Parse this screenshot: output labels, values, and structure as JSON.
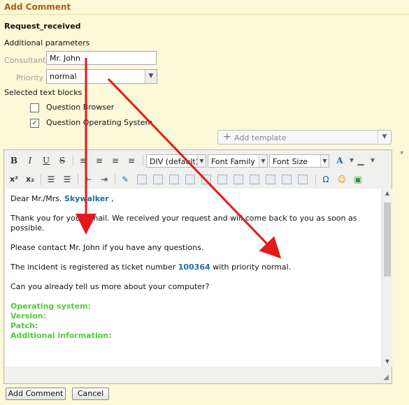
{
  "header": {
    "title": "Add Comment"
  },
  "template": {
    "name": "Request_received"
  },
  "form": {
    "additional_params_label": "Additional parameters",
    "consultant_label": "Consultant",
    "consultant_value": "Mr. John",
    "priority_label": "Priority",
    "priority_value": "normal",
    "selected_blocks_label": "Selected text blocks",
    "text_blocks": [
      {
        "label": "Question Browser",
        "checked": false
      },
      {
        "label": "Question Operating System",
        "checked": true
      }
    ],
    "add_template_label": "Add template",
    "required_marker": "*"
  },
  "toolbar": {
    "row1": {
      "bold": "B",
      "italic": "I",
      "underline": "U",
      "strike": "S",
      "format_select": "DIV (default)",
      "font_family_select": "Font Family",
      "font_size_select": "Font Size"
    },
    "row2": {
      "superscript": "x²",
      "subscript": "x₂",
      "omega": "Ω"
    }
  },
  "editor_content": {
    "greeting_prefix": "Dear Mr./Mrs.",
    "greeting_name": "Skywalker",
    "greeting_suffix": " ,",
    "thanks": "Thank you for your email. We received your request and will come back to you as soon as possible.",
    "contact": "Please contact Mr. John if you have any questions.",
    "ticket_prefix": "The incident is registered as ticket number",
    "ticket_number": "100364",
    "ticket_suffix": "with priority normal.",
    "question": "Can you already tell us more about your computer?",
    "fields": [
      "Operating system:",
      "Version:",
      "Patch:",
      "Additional information:"
    ]
  },
  "buttons": {
    "submit": "Add Comment",
    "cancel": "Cancel"
  },
  "colors": {
    "header_title": "#b45a1c",
    "link_blue": "#1c6e9f",
    "field_green": "#55c83c",
    "arrow_red": "#e21a1a",
    "background": "#fbf9d8"
  }
}
